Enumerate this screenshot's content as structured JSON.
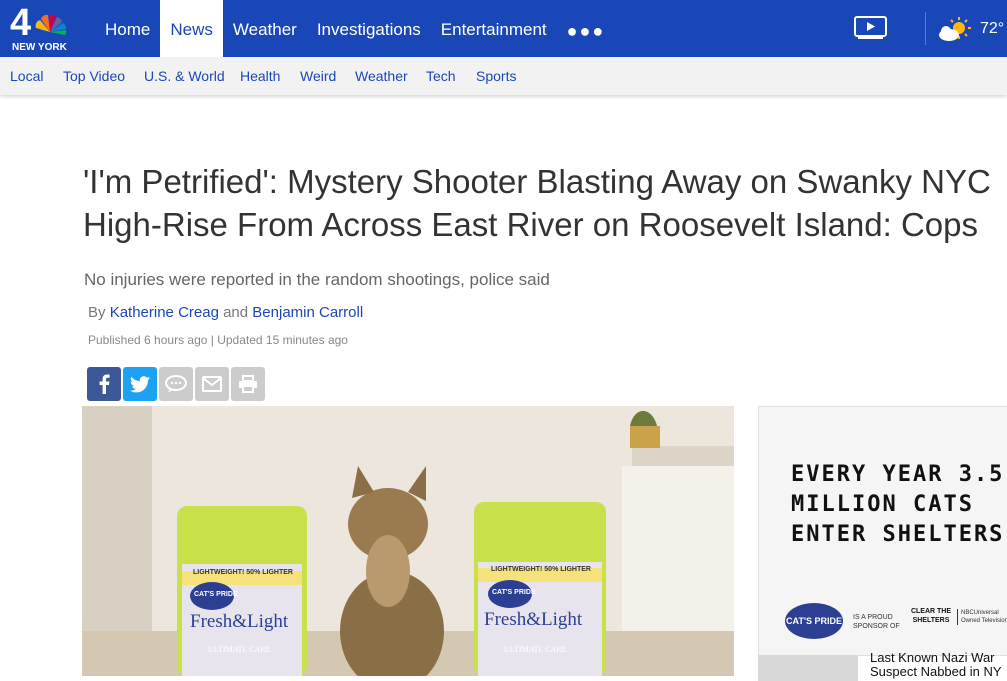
{
  "header": {
    "logo_number": "4",
    "logo_text": "NEW YORK",
    "nav": [
      {
        "label": "Home",
        "active": false
      },
      {
        "label": "News",
        "active": true
      },
      {
        "label": "Weather",
        "active": false
      },
      {
        "label": "Investigations",
        "active": false
      },
      {
        "label": "Entertainment",
        "active": false
      }
    ],
    "more_icon": "more-dots-icon",
    "video_icon": "video-play-icon",
    "weather_icon": "partly-sunny-icon",
    "temperature": "72°",
    "colors": {
      "brand": "#1a47b8",
      "active_bg": "#ffffff"
    }
  },
  "subnav": {
    "items": [
      "Local",
      "Top Video",
      "U.S. & World",
      "Health",
      "Weird",
      "Weather",
      "Tech",
      "Sports"
    ]
  },
  "article": {
    "headline_line1": "'I'm Petrified': Mystery Shooter Blasting Away on Swanky NYC",
    "headline_line2": "High-Rise From Across East River on Roosevelt Island: Cops",
    "dek": "No injuries were reported in the random shootings, police said",
    "byline_prefix": "By",
    "author1": "Katherine Creag",
    "byline_and": "and",
    "author2": "Benjamin Carroll",
    "published": "Published 6 hours ago | Updated 15 minutes ago",
    "share": [
      "facebook-icon",
      "twitter-icon",
      "comment-icon",
      "email-icon",
      "print-icon"
    ]
  },
  "media": {
    "product_label_top": "LIGHTWEIGHT! 50% LIGHTER",
    "brand": "CAT'S PRIDE",
    "product": "Fresh&Light",
    "subtitle": "ULTIMATE CARE"
  },
  "ad": {
    "lines": [
      "EVERY YEAR 3.5",
      "MILLION CATS",
      "ENTER SHELTERS"
    ],
    "brand": "CAT'S PRIDE",
    "sponsor_text": "IS A PROUD SPONSOR OF",
    "partner": "CLEAR THE SHELTERS",
    "nbcu": "NBCUniversal Owned Television"
  },
  "related": {
    "line1": "Last Known Nazi War",
    "line2": "Suspect Nabbed in NY"
  }
}
